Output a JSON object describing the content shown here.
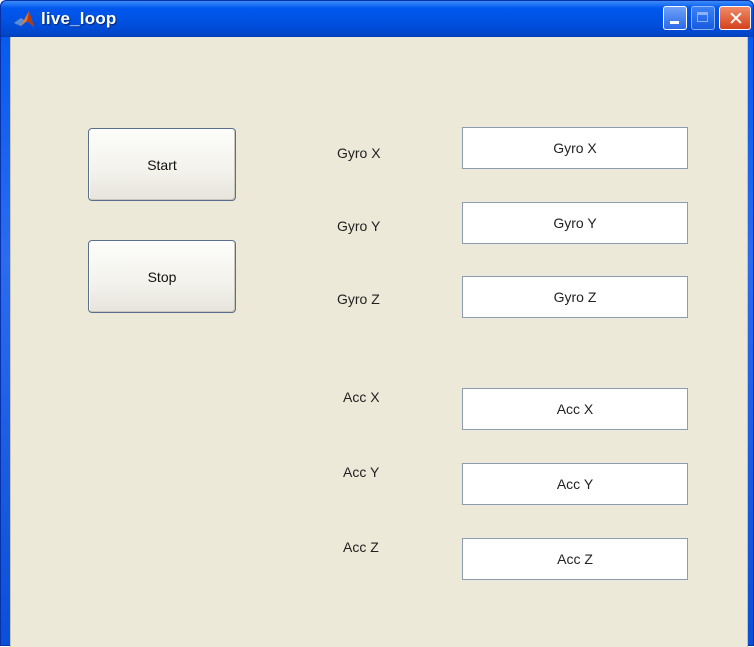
{
  "window": {
    "title": "live_loop",
    "controls": {
      "minimize_icon": "minimize-icon",
      "maximize_icon": "maximize-icon",
      "close_icon": "close-icon",
      "close_glyph": "✕"
    }
  },
  "buttons": {
    "start_label": "Start",
    "stop_label": "Stop"
  },
  "sensors": [
    {
      "label": "Gyro X",
      "value": "Gyro X"
    },
    {
      "label": "Gyro Y",
      "value": "Gyro Y"
    },
    {
      "label": "Gyro Z",
      "value": "Gyro Z"
    },
    {
      "label": "Acc X",
      "value": "Acc X"
    },
    {
      "label": "Acc Y",
      "value": "Acc Y"
    },
    {
      "label": "Acc Z",
      "value": "Acc Z"
    }
  ],
  "colors": {
    "titlebar": "#0058ee",
    "client_background": "#ece9d8",
    "close_button": "#d4421c"
  }
}
